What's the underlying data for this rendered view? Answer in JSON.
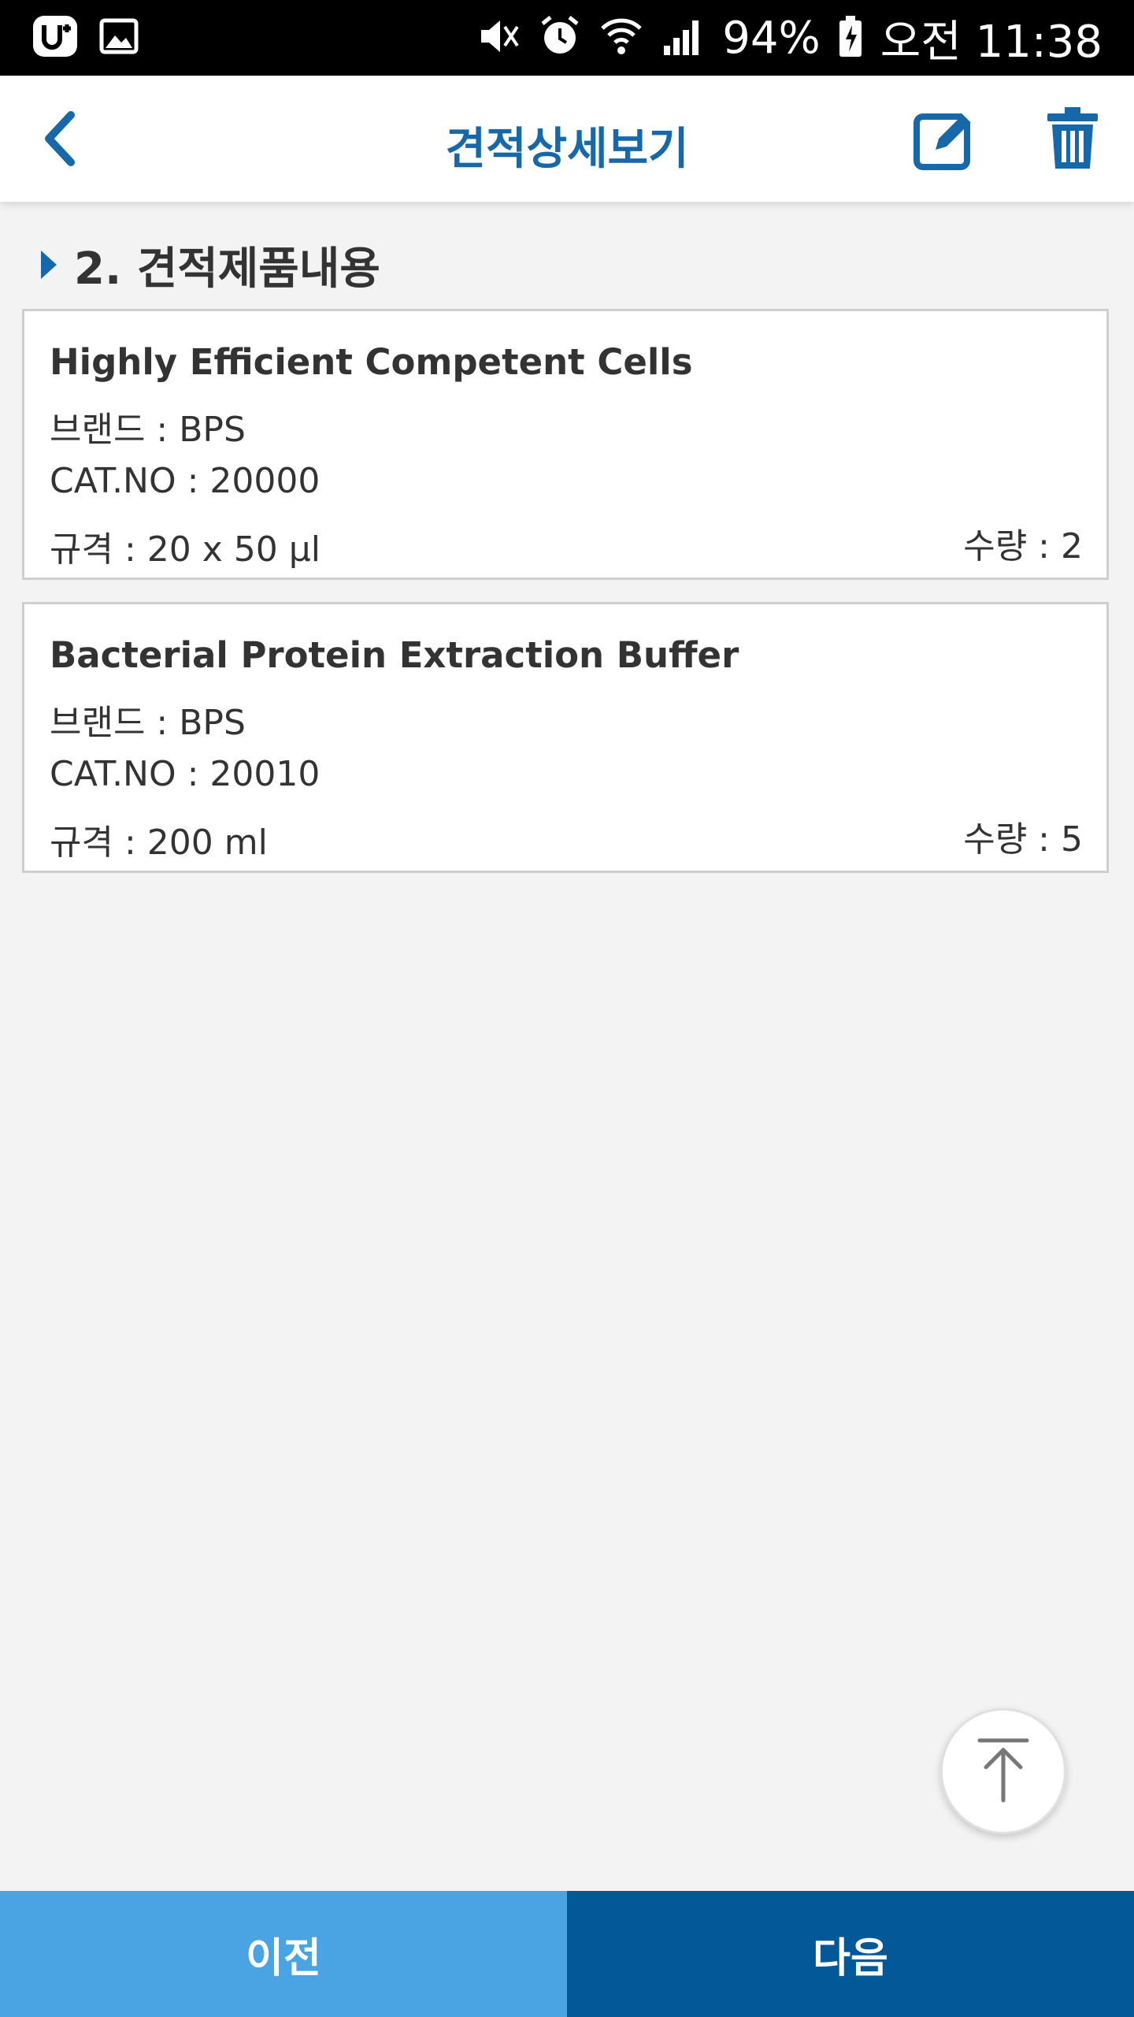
{
  "status_bar": {
    "battery": "94%",
    "time": "오전 11:38",
    "left_icons": [
      "u-plus-icon",
      "gallery-icon"
    ],
    "right_icons": [
      "mute-icon",
      "alarm-icon",
      "wifi-icon",
      "signal-icon",
      "battery-icon"
    ]
  },
  "header": {
    "title": "견적상세보기",
    "accent_color": "#1768a8"
  },
  "section": {
    "heading": "2. 견적제품내용"
  },
  "items": [
    {
      "name": "Highly Efficient Competent Cells",
      "brand": "브랜드 : BPS",
      "cat_no": "CAT.NO : 20000",
      "spec": "규격 : 20 x 50 μl",
      "qty": "수량 : 2"
    },
    {
      "name": "Bacterial Protein Extraction Buffer",
      "brand": "브랜드 : BPS",
      "cat_no": "CAT.NO : 20010",
      "spec": "규격 : 200 ml",
      "qty": "수량 : 5"
    }
  ],
  "footer": {
    "prev_label": "이전",
    "next_label": "다음",
    "prev_color": "#4aa3e2",
    "next_color": "#035998"
  }
}
